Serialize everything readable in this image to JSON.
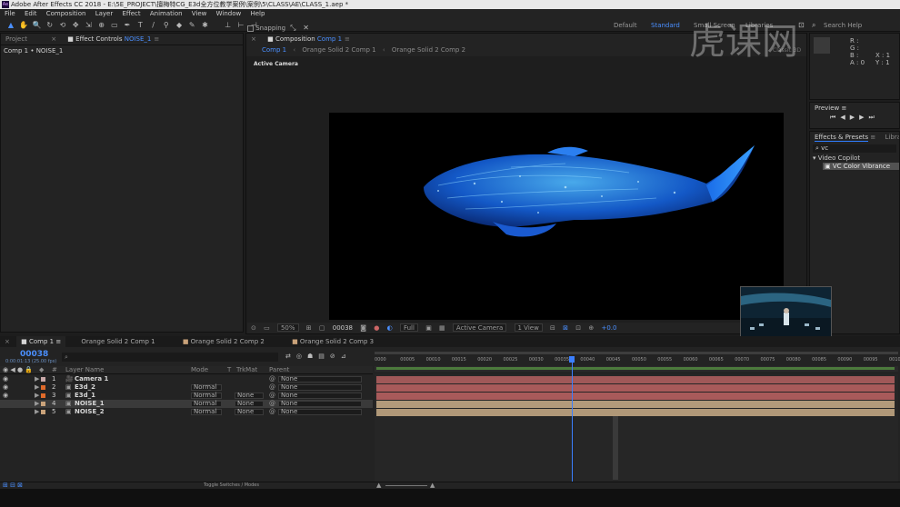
{
  "window": {
    "title": "Adobe After Effects CC 2018 - E:\\5E_PROJECT\\擅梅特CG_E3d全方位教学案例\\案例\\5\\CLASS\\AE\\CLASS_1.aep *",
    "app_icon_label": "Ae"
  },
  "menu": [
    "File",
    "Edit",
    "Composition",
    "Layer",
    "Effect",
    "Animation",
    "View",
    "Window",
    "Help"
  ],
  "toolbar": {
    "snapping": "Snapping",
    "workspaces": [
      "Default",
      "Standard",
      "Small Screen",
      "Libraries"
    ],
    "search": "Search Help"
  },
  "left_panel": {
    "tab_project": "Project",
    "tab_effect_controls": "Effect Controls",
    "effect_layer": "NOISE_1",
    "breadcrumb": "Comp 1 • NOISE_1"
  },
  "composition": {
    "panel_label": "Composition",
    "comp_name": "Comp 1",
    "sub_tabs": [
      "Comp 1",
      "Orange Solid 2 Comp 1",
      "Orange Solid 2 Comp 2"
    ],
    "view_label": "Active Camera",
    "watermark": "虎课网",
    "viewer_bar": {
      "zoom": "50%",
      "timecode": "00038",
      "resolution": "Full",
      "camera": "Active Camera",
      "views": "1 View",
      "exposure": "+0.0"
    }
  },
  "right_panel": {
    "preview_title": "Preview",
    "effects_title": "Effects & Presets",
    "libraries_title": "Librar",
    "search_value": "vc",
    "category": "Video Copilot",
    "effect_item": "VC Color Vibrance",
    "info_lines": [
      "R :",
      "G :",
      "B :",
      "A : 0",
      "X : 1",
      "Y : 1"
    ],
    "classic": "Classic 3D"
  },
  "timeline": {
    "tabs": [
      "Comp 1",
      "Orange Solid 2 Comp 1",
      "Orange Solid 2 Comp 2",
      "Orange Solid 2 Comp 3"
    ],
    "current_time": "00038",
    "current_time_sub": "0:00:01:13 (25.00 fps)",
    "columns": {
      "num": "#",
      "layer_name": "Layer Name",
      "mode": "Mode",
      "t": "T",
      "trkmat": "TrkMat",
      "parent": "Parent"
    },
    "layers": [
      {
        "num": "1",
        "name": "Camera 1",
        "mode": "",
        "trkmat": "",
        "parent": "None",
        "label_color": "#c9a9a9"
      },
      {
        "num": "2",
        "name": "E3d_2",
        "mode": "Normal",
        "trkmat": "",
        "parent": "None",
        "label_color": "#e06a2a"
      },
      {
        "num": "3",
        "name": "E3d_1",
        "mode": "Normal",
        "trkmat": "None",
        "parent": "None",
        "label_color": "#e06a2a"
      },
      {
        "num": "4",
        "name": "NOISE_1",
        "mode": "Normal",
        "trkmat": "None",
        "parent": "None",
        "label_color": "#c9a27a"
      },
      {
        "num": "5",
        "name": "NOISE_2",
        "mode": "Normal",
        "trkmat": "None",
        "parent": "None",
        "label_color": "#c9a27a"
      }
    ],
    "ruler": [
      "0000",
      "00005",
      "00010",
      "00015",
      "00020",
      "00025",
      "00030",
      "00035",
      "00040",
      "00045",
      "00050",
      "00055",
      "00060",
      "00065",
      "00070",
      "00075",
      "00080",
      "00085",
      "00090",
      "00095",
      "00100"
    ],
    "bar_colors": [
      "#a05858",
      "#a85a5a",
      "#a85a5a",
      "#b39a7a",
      "#b09878"
    ],
    "playhead_fraction": 0.38,
    "toggle_label": "Toggle Switches / Modes"
  }
}
